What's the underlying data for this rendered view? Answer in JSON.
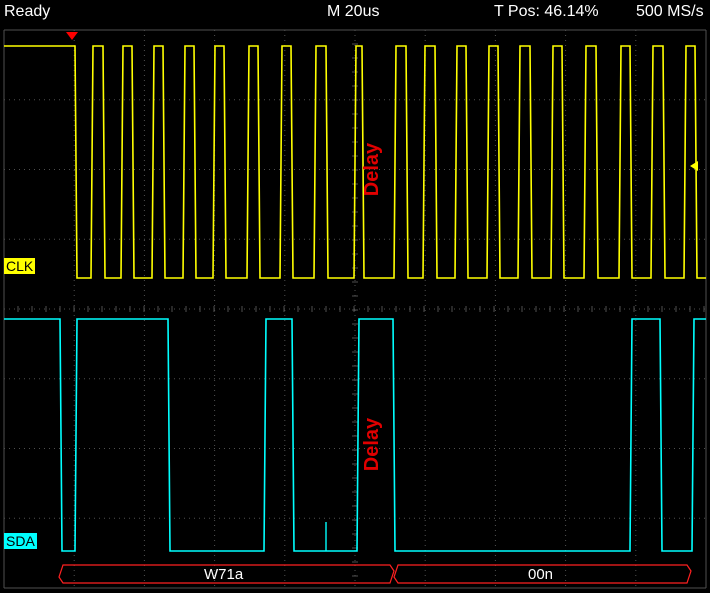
{
  "status": {
    "state": "Ready",
    "timebase": "M 20us",
    "trigger_position": "T Pos: 46.14%",
    "sample_rate": "500 MS/s"
  },
  "channels": {
    "clk": {
      "label": "CLK",
      "color": "#ffff00"
    },
    "sda": {
      "label": "SDA",
      "color": "#00ffff"
    }
  },
  "annotations": {
    "clk_delay": "Delay",
    "sda_delay": "Delay"
  },
  "bus_decode": {
    "color": "#ff2020",
    "segments": [
      "W71a",
      "00n"
    ]
  },
  "colors": {
    "grid": "#505050",
    "trigger_marker": "#ff0000",
    "background": "#000000"
  }
}
